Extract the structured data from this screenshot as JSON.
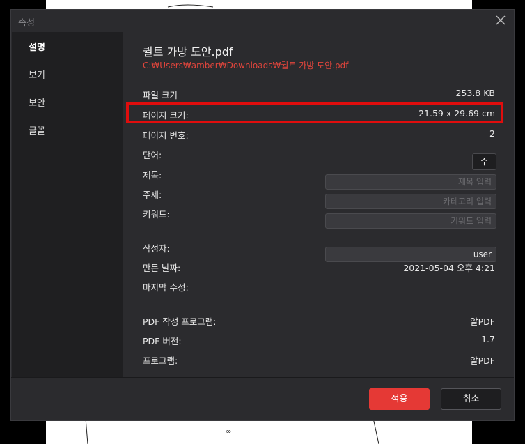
{
  "dialog": {
    "title": "속성",
    "close_icon": "close-icon"
  },
  "sidebar": {
    "items": [
      {
        "label": "설명",
        "active": true
      },
      {
        "label": "보기",
        "active": false
      },
      {
        "label": "보안",
        "active": false
      },
      {
        "label": "글꼴",
        "active": false
      }
    ]
  },
  "file": {
    "name": "퀼트 가방 도안.pdf",
    "path": "C:₩Users₩amber₩Downloads₩퀼트 가방 도안.pdf"
  },
  "properties": {
    "file_size_label": "파일 크기",
    "file_size_value": "253.8 KB",
    "page_size_label": "페이지 크기:",
    "page_size_value": "21.59 x 29.69 cm",
    "page_number_label": "페이지 번호:",
    "page_number_value": "2",
    "words_label": "단어:",
    "words_button": "수",
    "title_label": "제목:",
    "title_placeholder": "제목 입력",
    "subject_label": "주제:",
    "subject_placeholder": "카테고리 입력",
    "keywords_label": "키워드:",
    "keywords_placeholder": "키워드 입력",
    "author_label": "작성자:",
    "author_value": "user",
    "created_label": "만든 날짜:",
    "created_value": "2021-05-04 오후 4:21",
    "modified_label": "마지막 수정:",
    "modified_value": "",
    "producer_label": "PDF 작성 프로그램:",
    "producer_value": "알PDF",
    "version_label": "PDF 버전:",
    "version_value": "1.7",
    "program_label": "프로그램:",
    "program_value": "알PDF"
  },
  "footer": {
    "apply_label": "적용",
    "cancel_label": "취소"
  },
  "colors": {
    "accent": "#e53935",
    "highlight_box": "#e00d0d",
    "path_text": "#e0453c"
  }
}
